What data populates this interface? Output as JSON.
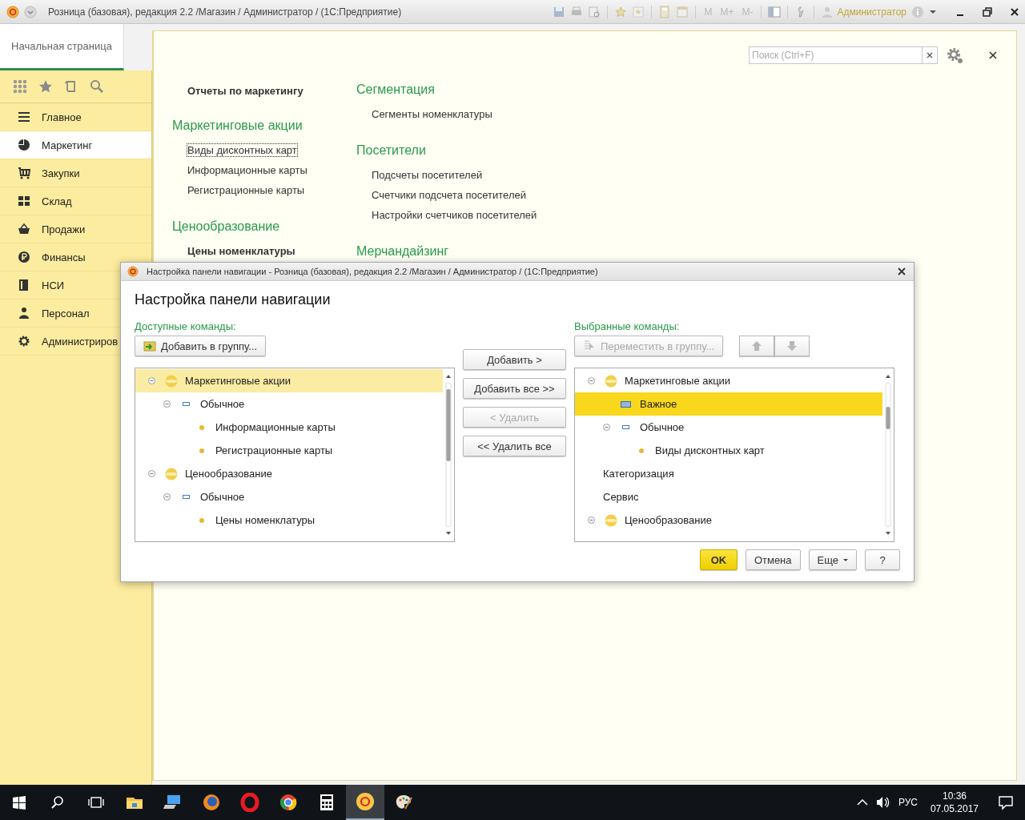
{
  "window": {
    "title": "Розница (базовая), редакция 2.2 /Магазин / Администратор /  (1С:Предприятие)",
    "memory_buttons": [
      "M",
      "M+",
      "M-"
    ],
    "user": "Администратор"
  },
  "home_tab": {
    "label": "Начальная страница",
    "selected": true
  },
  "sidebar": {
    "items": [
      {
        "label": "Главное",
        "selected": false
      },
      {
        "label": "Маркетинг",
        "selected": true
      },
      {
        "label": "Закупки",
        "selected": false
      },
      {
        "label": "Склад",
        "selected": false
      },
      {
        "label": "Продажи",
        "selected": false
      },
      {
        "label": "Финансы",
        "selected": false
      },
      {
        "label": "НСИ",
        "selected": false
      },
      {
        "label": "Персонал",
        "selected": false
      },
      {
        "label": "Администриров",
        "selected": false
      }
    ]
  },
  "search": {
    "placeholder": "Поиск (Ctrl+F)"
  },
  "content": {
    "columns": [
      [
        {
          "kind": "bold",
          "text": "Отчеты по маркетингу"
        },
        {
          "kind": "heading",
          "text": "Маркетинговые акции"
        },
        {
          "kind": "link",
          "text": "Виды дисконтных карт",
          "focused": true
        },
        {
          "kind": "link",
          "text": "Информационные карты",
          "focused": false
        },
        {
          "kind": "link",
          "text": "Регистрационные карты",
          "focused": false
        },
        {
          "kind": "heading",
          "text": "Ценообразование"
        },
        {
          "kind": "bold",
          "text": "Цены номенклатуры"
        }
      ],
      [
        {
          "kind": "heading",
          "text": "Сегментация"
        },
        {
          "kind": "link",
          "text": "Сегменты номенклатуры",
          "focused": false
        },
        {
          "kind": "heading",
          "text": "Посетители"
        },
        {
          "kind": "link",
          "text": "Подсчеты посетителей",
          "focused": false
        },
        {
          "kind": "link",
          "text": "Счетчики подсчета посетителей",
          "focused": false
        },
        {
          "kind": "link",
          "text": "Настройки счетчиков посетителей",
          "focused": false
        },
        {
          "kind": "heading",
          "text": "Мерчандайзинг"
        }
      ]
    ]
  },
  "dialog": {
    "title": "Настройка панели навигации - Розница (базовая), редакция 2.2 /Магазин / Администратор /  (1С:Предприятие)",
    "heading": "Настройка панели навигации",
    "left": {
      "label": "Доступные команды:",
      "button": {
        "label": "Добавить в группу...",
        "disabled": false
      },
      "focused": false,
      "tree": [
        {
          "kind": "group",
          "text": "Маркетинговые акции",
          "expanded": true,
          "selected": true,
          "children": [
            {
              "kind": "subgroup",
              "text": "Обычное",
              "expanded": true,
              "selected": false,
              "children": [
                {
                  "kind": "item",
                  "text": "Информационные карты",
                  "selected": false
                },
                {
                  "kind": "item",
                  "text": "Регистрационные карты",
                  "selected": false
                }
              ]
            }
          ]
        },
        {
          "kind": "group",
          "text": "Ценообразование",
          "expanded": true,
          "selected": false,
          "children": [
            {
              "kind": "subgroup",
              "text": "Обычное",
              "expanded": true,
              "selected": false,
              "children": [
                {
                  "kind": "item",
                  "text": "Цены номенклатуры",
                  "selected": false
                }
              ]
            }
          ]
        }
      ]
    },
    "middle_buttons": [
      {
        "label": "Добавить >",
        "disabled": false
      },
      {
        "label": "Добавить все >>",
        "disabled": false
      },
      {
        "label": "< Удалить",
        "disabled": true
      },
      {
        "label": "<< Удалить все",
        "disabled": false
      }
    ],
    "right": {
      "label": "Выбранные команды:",
      "button": {
        "label": "Переместить в группу...",
        "disabled": true
      },
      "focused": true,
      "tree": [
        {
          "kind": "group",
          "text": "Маркетинговые акции",
          "expanded": true,
          "selected": false,
          "children": [
            {
              "kind": "important",
              "text": "Важное",
              "selected": true
            },
            {
              "kind": "subgroup",
              "text": "Обычное",
              "expanded": true,
              "selected": false,
              "children": [
                {
                  "kind": "item",
                  "text": "Виды дисконтных карт",
                  "selected": false
                }
              ]
            },
            {
              "kind": "plain",
              "text": "Категоризация",
              "selected": false
            },
            {
              "kind": "plain",
              "text": "Сервис",
              "selected": false
            }
          ]
        },
        {
          "kind": "group",
          "text": "Ценообразование",
          "expanded": true,
          "selected": false
        }
      ]
    },
    "footer_buttons": [
      {
        "label": "OK",
        "kind": "default"
      },
      {
        "label": "Отмена",
        "kind": "normal"
      },
      {
        "label": "Еще",
        "kind": "menu"
      },
      {
        "label": "?",
        "kind": "normal"
      }
    ]
  },
  "taskbar": {
    "apps": [
      {
        "active": false
      },
      {
        "active": false
      },
      {
        "active": false
      },
      {
        "active": false
      },
      {
        "active": false
      },
      {
        "active": false
      },
      {
        "active": true
      },
      {
        "active": false
      }
    ],
    "language": "РУС",
    "time": "10:36",
    "date": "07.05.2017"
  }
}
